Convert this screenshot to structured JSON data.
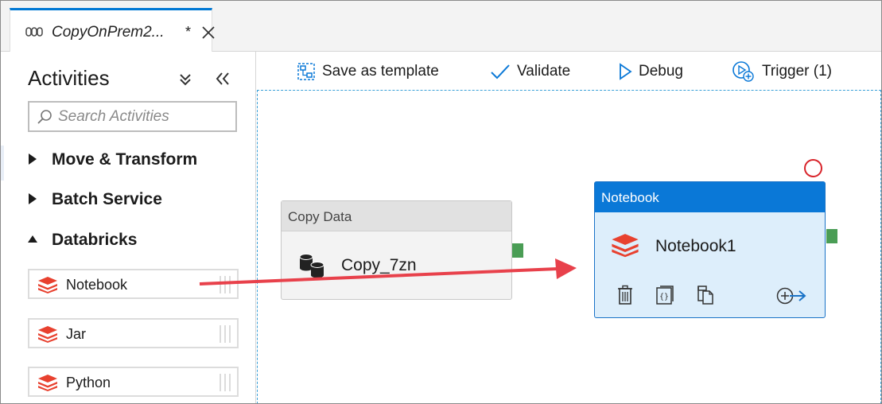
{
  "tab": {
    "title": "CopyOnPrem2...",
    "dirty_marker": "*"
  },
  "sidebar": {
    "title": "Activities",
    "search": {
      "placeholder": "Search Activities",
      "value": ""
    },
    "categories": [
      {
        "label": "Move & Transform",
        "expanded": false
      },
      {
        "label": "Batch Service",
        "expanded": false
      },
      {
        "label": "Databricks",
        "expanded": true
      }
    ],
    "activities": [
      {
        "label": "Notebook",
        "icon": "databricks-icon"
      },
      {
        "label": "Jar",
        "icon": "databricks-icon"
      },
      {
        "label": "Python",
        "icon": "databricks-icon"
      }
    ]
  },
  "toolbar": {
    "save_template_label": "Save as template",
    "validate_label": "Validate",
    "debug_label": "Debug",
    "trigger_label": "Trigger (1)"
  },
  "canvas": {
    "copy_activity": {
      "header": "Copy Data",
      "name": "Copy_7zn",
      "icon": "copy-data-icon"
    },
    "notebook_activity": {
      "header": "Notebook",
      "name": "Notebook1",
      "icon": "databricks-icon",
      "actions": [
        "delete-icon",
        "code-icon",
        "clone-icon",
        "add-output-icon"
      ]
    }
  },
  "colors": {
    "accent": "#0078d4",
    "notebook_header": "#0a78d7",
    "notebook_body": "#ddeefb",
    "port_green": "#4a9d55",
    "databricks_red": "#e8412f",
    "drag_arrow": "#e8414b",
    "validation_circle": "#d8232a"
  }
}
